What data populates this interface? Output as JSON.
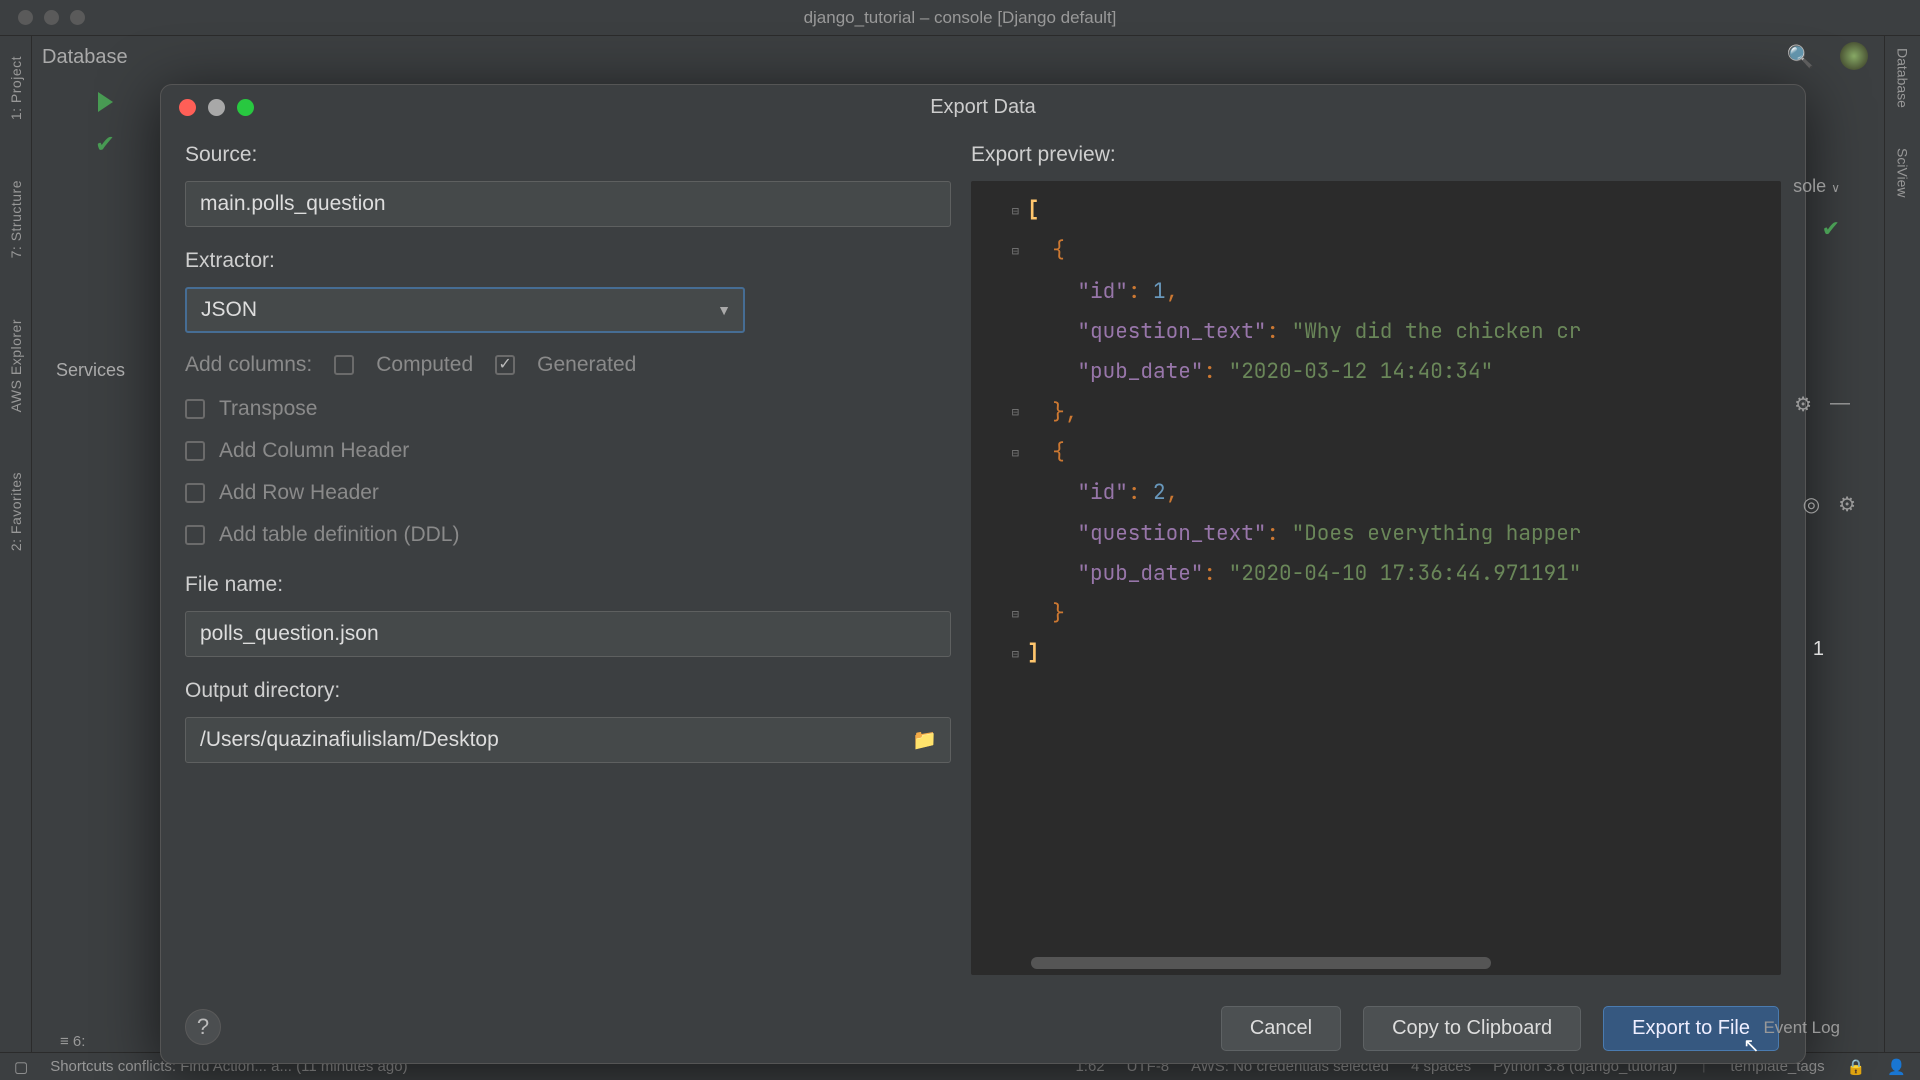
{
  "window_title": "django_tutorial – console [Django default]",
  "top_tabs": {
    "database_label": "Database",
    "services_label": "Services"
  },
  "left_gutter": [
    "1: Project",
    "7: Structure",
    "AWS Explorer",
    "2: Favorites"
  ],
  "right_gutter": [
    "Database",
    "SciView"
  ],
  "dialog": {
    "title": "Export Data",
    "source_label": "Source:",
    "source_value": "main.polls_question",
    "extractor_label": "Extractor:",
    "extractor_value": "JSON",
    "add_columns_label": "Add columns:",
    "computed_label": "Computed",
    "generated_label": "Generated",
    "transpose_label": "Transpose",
    "add_col_header_label": "Add Column Header",
    "add_row_header_label": "Add Row Header",
    "add_ddl_label": "Add table definition (DDL)",
    "file_name_label": "File name:",
    "file_name_value": "polls_question.json",
    "output_dir_label": "Output directory:",
    "output_dir_value": "/Users/quazinafiulislam/Desktop",
    "preview_label": "Export preview:",
    "cancel_label": "Cancel",
    "copy_label": "Copy to Clipboard",
    "export_label": "Export to File"
  },
  "preview": {
    "row1": {
      "id_key": "\"id\"",
      "id_val": "1",
      "qt_key": "\"question_text\"",
      "qt_val": "\"Why did the chicken cr",
      "pd_key": "\"pub_date\"",
      "pd_val": "\"2020-03-12 14:40:34\""
    },
    "row2": {
      "id_key": "\"id\"",
      "id_val": "2",
      "qt_key": "\"question_text\"",
      "qt_val": "\"Does everything happer",
      "pd_key": "\"pub_date\"",
      "pd_val": "\"2020-04-10 17:36:44.971191\""
    }
  },
  "status": {
    "shortcuts": "Shortcuts conflicts: Find Action... a... (11 minutes ago)",
    "pos": "1:62",
    "enc": "UTF-8",
    "aws": "AWS: No credentials selected",
    "indent": "4 spaces",
    "python": "Python 3.8 (django_tutorial)",
    "branch": "template_tags",
    "event_log": "Event Log",
    "left_num": "6:"
  },
  "hidden_right": {
    "sole": "sole",
    "one": "1"
  }
}
